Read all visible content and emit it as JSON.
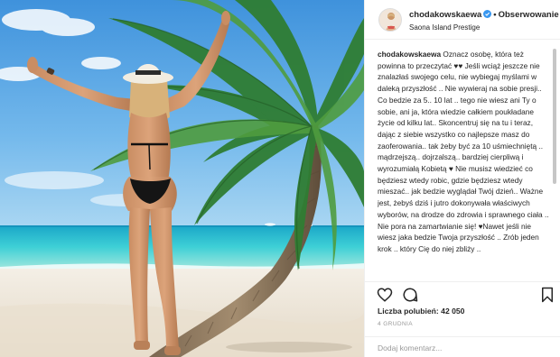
{
  "post": {
    "username": "chodakowskaewa",
    "follow_label": "Obserwowanie",
    "location": "Saona Island Prestige",
    "caption": {
      "username": "chodakowskaewa",
      "part1": "Oznacz osobę, która też powinna to przeczytać ",
      "part2": " Jeśli wciąż jeszcze nie znalazłaś swojego celu, nie wybiegaj myślami w daleką przyszłość .. Nie wywieraj na sobie presji.. Co bedzie za 5.. 10 lat .. tego nie wiesz ani Ty o sobie, ani ja, która wiedzie całkiem poukładane życie od kilku lat.. Skoncentruj się na tu i teraz, dając z siebie wszystko co najlepsze masz do zaoferowania.. tak żeby być za 10 uśmiechniętą .. mądrzejszą.. dojrzalszą.. bardziej cierpliwą i wyrozumiałą Kobietą ",
      "part3": " Nie musisz wiedzieć co będziesz wtedy robic, gdzie będziesz wtedy mieszać.. jak bedzie wyglądał Twój dzień.. Ważne jest, żebyś dziś i jutro dokonywała właściwych wyborów, na drodze do zdrowia i sprawnego ciała .. Nie pora na zamartwianie się! ",
      "part4": "Nawet jeśli nie wiesz jaka bedzie Twoja przyszłość .. Zrób jeden krok .. który Cię do niej zbliży ..",
      "heart": "♥"
    },
    "likes_label": "Liczba polubień: 42 050",
    "date": "4 GRUDNIA",
    "comment_placeholder": "Dodaj komentarz..."
  },
  "icons": {
    "verified": "verified-badge-icon",
    "like": "heart-outline-icon",
    "comment": "speech-bubble-icon",
    "save": "bookmark-icon"
  },
  "colors": {
    "verified": "#3897f0",
    "text": "#262626",
    "muted": "#999999",
    "sky": "#5aa8e6",
    "sea": "#2fc3d1",
    "sand": "#f2ece2"
  }
}
